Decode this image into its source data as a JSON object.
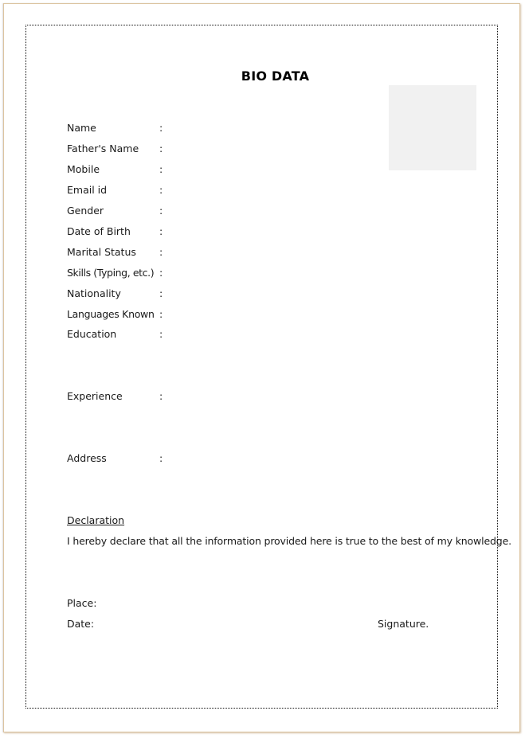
{
  "document": {
    "title": "BIO DATA",
    "photo_placeholder": "photo-box",
    "fields": [
      {
        "label": "Name",
        "separator": ":",
        "value": ""
      },
      {
        "label": "Father's Name",
        "separator": ":",
        "value": ""
      },
      {
        "label": "Mobile",
        "separator": ":",
        "value": ""
      },
      {
        "label": "Email id",
        "separator": ":",
        "value": ""
      },
      {
        "label": "Gender",
        "separator": ":",
        "value": ""
      },
      {
        "label": "Date of Birth",
        "separator": ":",
        "value": ""
      },
      {
        "label": "Marital Status",
        "separator": ":",
        "value": ""
      },
      {
        "label": "Skills (Typing, etc.)",
        "separator": ":",
        "value": ""
      },
      {
        "label": "Nationality",
        "separator": ":",
        "value": ""
      },
      {
        "label": "Languages Known",
        "separator": ":",
        "value": ""
      },
      {
        "label": "Education",
        "separator": ":",
        "value": ""
      },
      {
        "label": "Experience",
        "separator": ":",
        "value": ""
      },
      {
        "label": "Address",
        "separator": ":",
        "value": ""
      }
    ],
    "declaration": {
      "heading": "Declaration",
      "text": "I hereby declare that all the information provided here is true to the best of my knowledge."
    },
    "footer": {
      "place_label": "Place:",
      "date_label": "Date:",
      "signature_label": "Signature."
    }
  },
  "colors": {
    "page_border": "#dcc4a0",
    "photo_box": "#f1f1f1",
    "text": "#1a1a1a"
  }
}
